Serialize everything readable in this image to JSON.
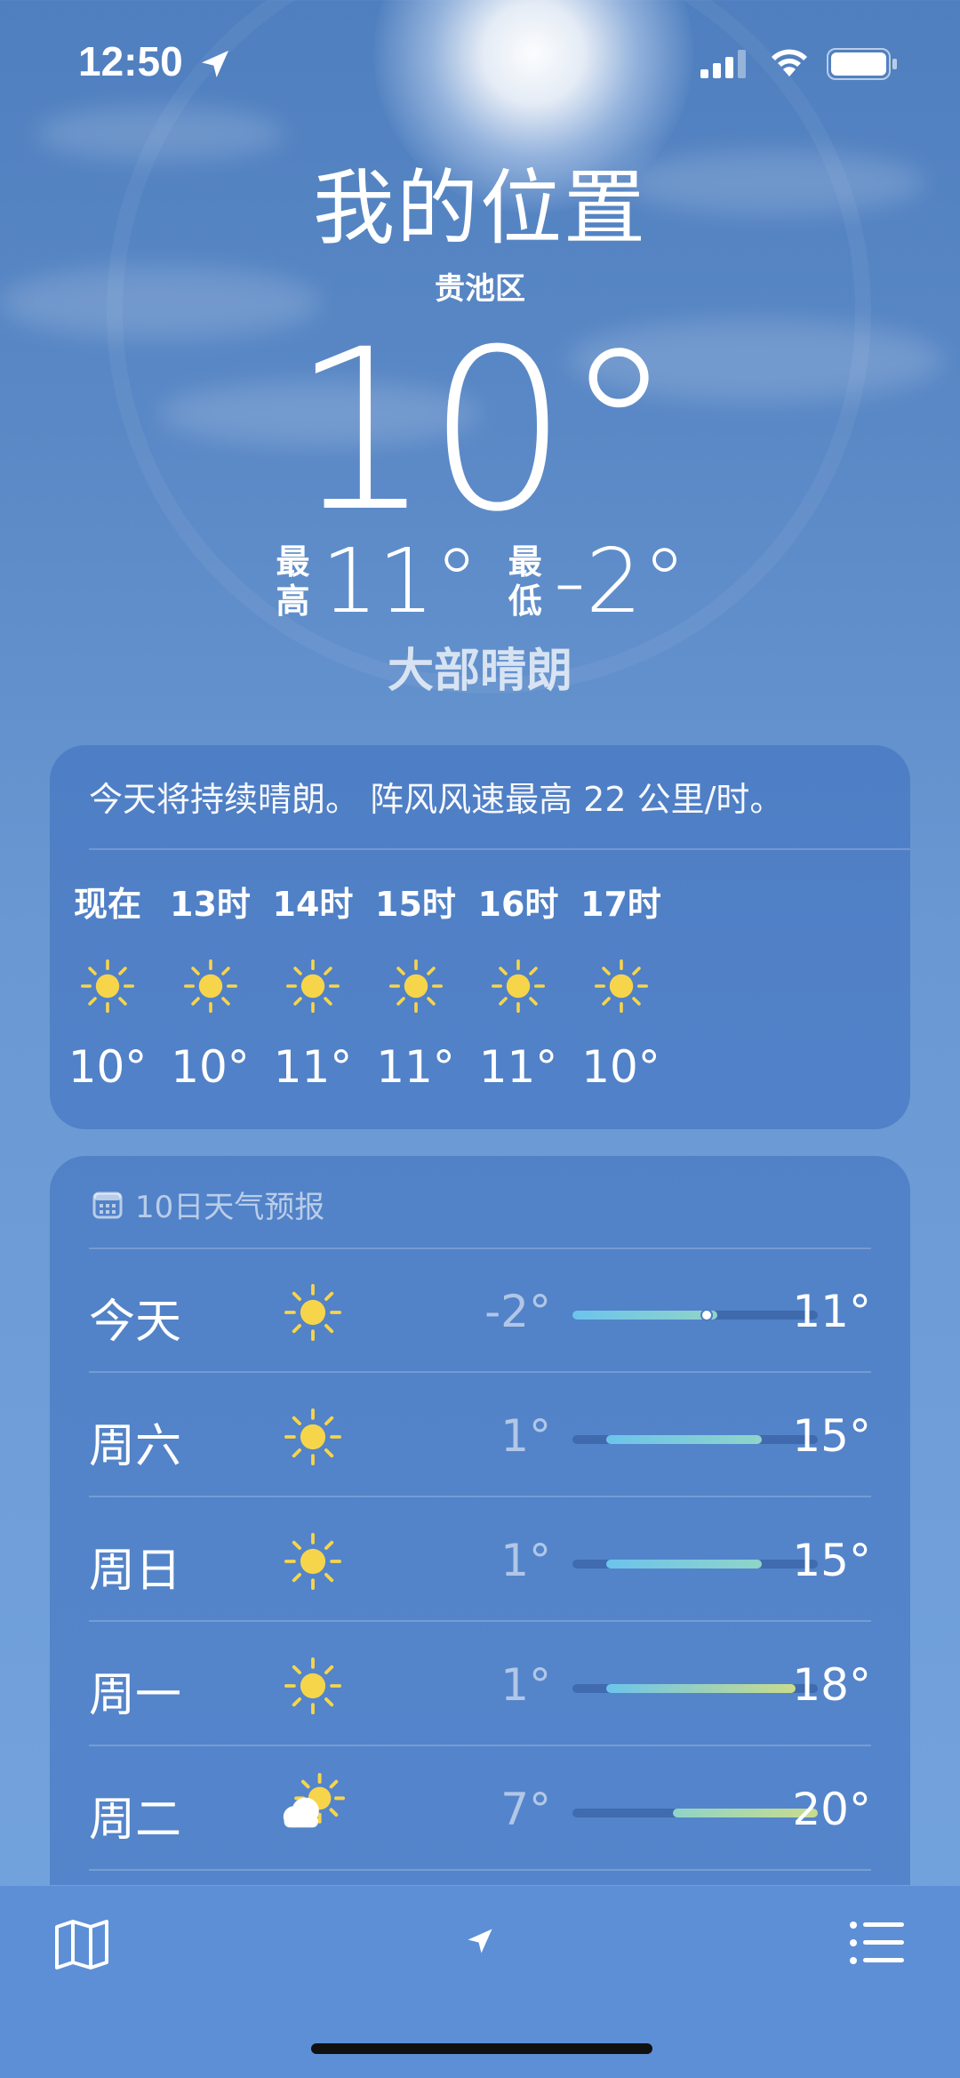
{
  "status_bar": {
    "time": "12:50"
  },
  "header": {
    "place": "我的位置",
    "district": "贵池区",
    "temperature": "10°",
    "high_label": "最高",
    "high": "11°",
    "low_label": "最低",
    "low": "-2°",
    "condition": "大部晴朗"
  },
  "hourly": {
    "summary": "今天将持续晴朗。 阵风风速最高 22 公里/时。",
    "items": [
      {
        "time": "现在",
        "icon": "sun-icon",
        "temp": "10°"
      },
      {
        "time": "13时",
        "icon": "sun-icon",
        "temp": "10°"
      },
      {
        "time": "14时",
        "icon": "sun-icon",
        "temp": "11°"
      },
      {
        "time": "15时",
        "icon": "sun-icon",
        "temp": "11°"
      },
      {
        "time": "16时",
        "icon": "sun-icon",
        "temp": "11°"
      },
      {
        "time": "17时",
        "icon": "sun-icon",
        "temp": "10°"
      }
    ]
  },
  "daily": {
    "title": "10日天气预报",
    "range": {
      "min": -2,
      "max": 20
    },
    "days": [
      {
        "name": "今天",
        "icon": "sun-icon",
        "low": "-2°",
        "high": "11°",
        "lo": -2,
        "hi": 11,
        "current": 10
      },
      {
        "name": "周六",
        "icon": "sun-icon",
        "low": "1°",
        "high": "15°",
        "lo": 1,
        "hi": 15
      },
      {
        "name": "周日",
        "icon": "sun-icon",
        "low": "1°",
        "high": "15°",
        "lo": 1,
        "hi": 15
      },
      {
        "name": "周一",
        "icon": "sun-icon",
        "low": "1°",
        "high": "18°",
        "lo": 1,
        "hi": 18
      },
      {
        "name": "周二",
        "icon": "cloud-sun-icon",
        "low": "7°",
        "high": "20°",
        "lo": 7,
        "hi": 20
      }
    ]
  },
  "colors": {
    "sun": "#f7d54a",
    "bar_cool": "#6cc4ec",
    "bar_mild": "#8fd4c8",
    "bar_warm": "#c9dc8c"
  }
}
